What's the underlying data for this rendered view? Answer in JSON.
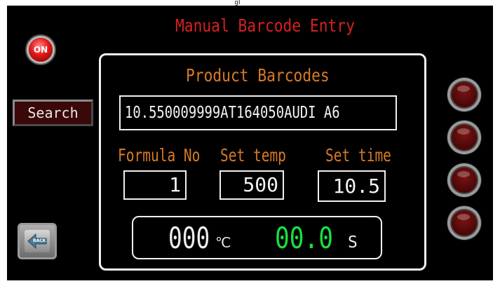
{
  "top_tab": {
    "text": "gl"
  },
  "header": {
    "title": "Manual Barcode Entry"
  },
  "on_button": {
    "label": "ON"
  },
  "search_button": {
    "label": "Search"
  },
  "panel": {
    "title": "Product Barcodes",
    "barcode_value": "10.550009999AT164050AUDI A6"
  },
  "fields": {
    "formula_no": {
      "label": "Formula No",
      "value": "1"
    },
    "set_temp": {
      "label": "Set temp",
      "value": "500"
    },
    "set_time": {
      "label": "Set time",
      "value": "10.5"
    }
  },
  "readout": {
    "temperature": "000",
    "temperature_unit": "℃",
    "time": "00.0",
    "time_unit": "S"
  },
  "back_button": {
    "label": "BACK",
    "icon": "back-arrow-icon"
  },
  "indicator_lamps": [
    "lamp-1",
    "lamp-2",
    "lamp-3",
    "lamp-4"
  ],
  "colors": {
    "background": "#000000",
    "title_red": "#d82020",
    "label_orange": "#d97a28",
    "time_green": "#19e040",
    "border_white": "#f0f0f0"
  }
}
